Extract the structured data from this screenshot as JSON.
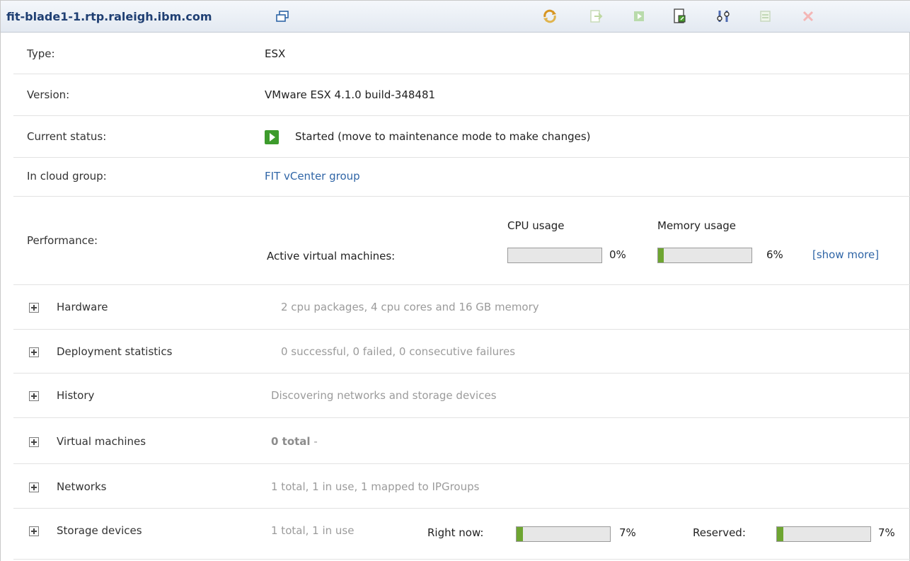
{
  "header": {
    "title": "fit-blade1-1.rtp.raleigh.ibm.com",
    "toolbar": [
      {
        "name": "refresh-icon"
      },
      {
        "name": "move-to-maintenance-icon"
      },
      {
        "name": "start-icon"
      },
      {
        "name": "export-icon"
      },
      {
        "name": "settings-icon"
      },
      {
        "name": "discover-icon"
      },
      {
        "name": "delete-icon"
      }
    ]
  },
  "details": {
    "type_label": "Type:",
    "type_value": "ESX",
    "version_label": "Version:",
    "version_value": "VMware ESX 4.1.0 build-348481",
    "status_label": "Current status:",
    "status_value": "Started (move to maintenance mode to make changes)",
    "cloud_label": "In cloud group:",
    "cloud_value": "FIT vCenter group",
    "performance_label": "Performance:",
    "active_vms_label": "Active virtual machines:",
    "cpu_label": "CPU usage",
    "cpu_value": "0%",
    "cpu_fraction": 0,
    "memory_label": "Memory usage",
    "memory_value": "6%",
    "memory_fraction": 0.06,
    "show_more": "[show more]"
  },
  "sections": {
    "hardware": {
      "label": "Hardware",
      "summary": "2 cpu packages, 4 cpu cores and 16 GB memory"
    },
    "deployment": {
      "label": "Deployment statistics",
      "summary": "0 successful, 0 failed, 0 consecutive failures"
    },
    "history": {
      "label": "History",
      "summary": "Discovering networks and storage devices"
    },
    "vms": {
      "label": "Virtual machines",
      "summary_bold": "0 total",
      "summary_rest": " -"
    },
    "networks": {
      "label": "Networks",
      "summary": "1 total, 1 in use, 1 mapped to IPGroups"
    },
    "storage": {
      "label": "Storage devices",
      "summary": "1 total, 1 in use",
      "right_now_label": "Right now:",
      "right_now_value": "7%",
      "right_now_fraction": 0.07,
      "reserved_label": "Reserved:",
      "reserved_value": "7%",
      "reserved_fraction": 0.07
    }
  }
}
